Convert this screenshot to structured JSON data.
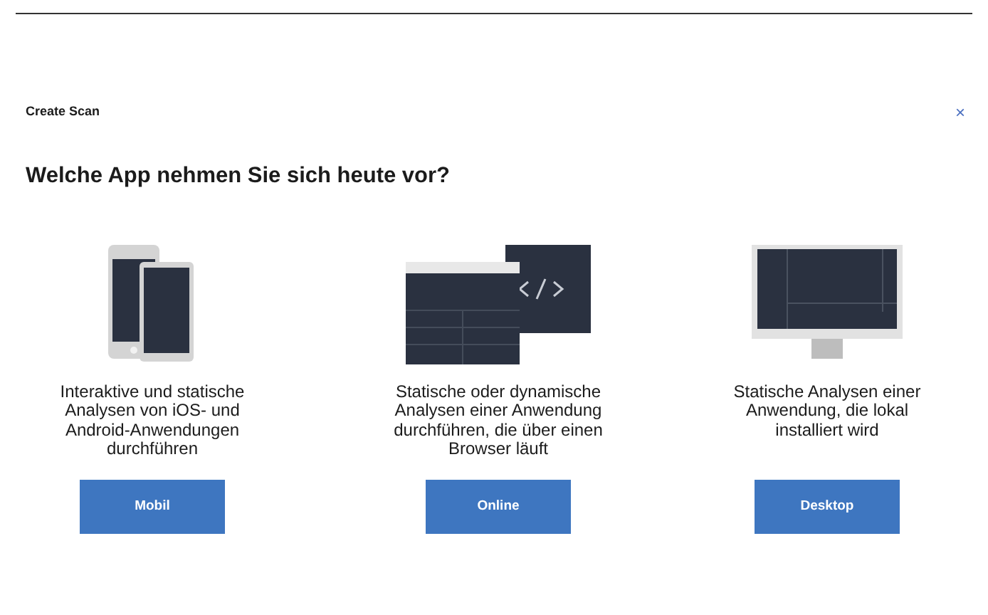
{
  "dialog": {
    "title": "Create Scan",
    "close": "×"
  },
  "heading": "Welche App nehmen Sie sich heute vor?",
  "options": [
    {
      "kind": "mobile",
      "description": "Interaktive und statische Analysen von iOS- und Android-Anwendungen durchführen",
      "button": "Mobil"
    },
    {
      "kind": "online",
      "description": "Statische oder dynamische Analysen einer Anwendung durchführen, die über einen Browser läuft",
      "button": "Online"
    },
    {
      "kind": "desktop",
      "description": "Statische Analysen einer Anwendung, die lokal installiert wird",
      "button": "Desktop"
    }
  ]
}
